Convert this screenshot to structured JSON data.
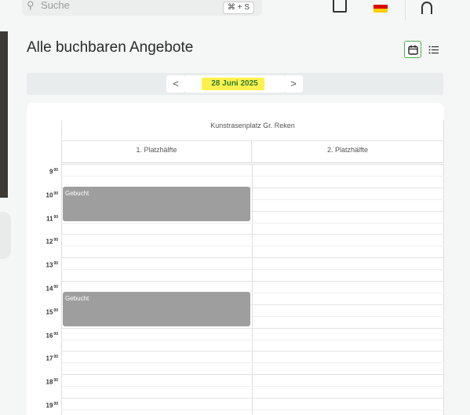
{
  "header": {
    "search_placeholder": "Suche",
    "shortcut": "⌘ + S",
    "flag_colors": [
      "#000000",
      "#dd0000",
      "#ffce00"
    ]
  },
  "page": {
    "title": "Alle buchbaren Angebote"
  },
  "view_toggle": {
    "active": "calendar",
    "options": [
      "calendar",
      "list"
    ],
    "accent_color": "#4caf50"
  },
  "date_nav": {
    "prev": "<",
    "date": "28 Juni 2025",
    "next": ">",
    "highlight_color": "#fff14d"
  },
  "calendar": {
    "venue": "Kunstrasenplatz Gr. Reken",
    "columns": [
      "1. Platzhälfte",
      "2. Platzhälfte"
    ],
    "hours": [
      {
        "h": "9",
        "m": "00"
      },
      {
        "h": "10",
        "m": "00"
      },
      {
        "h": "11",
        "m": "00"
      },
      {
        "h": "12",
        "m": "00"
      },
      {
        "h": "13",
        "m": "00"
      },
      {
        "h": "14",
        "m": "00"
      },
      {
        "h": "15",
        "m": "00"
      },
      {
        "h": "16",
        "m": "00"
      },
      {
        "h": "17",
        "m": "00"
      },
      {
        "h": "18",
        "m": "00"
      },
      {
        "h": "19",
        "m": "00"
      }
    ],
    "bookings": [
      {
        "label": "Gebucht",
        "column": "1. Platzhälfte",
        "start": "10:30",
        "end": "12:00"
      },
      {
        "label": "Gebucht",
        "column": "1. Platzhälfte",
        "start": "15:00",
        "end": "16:30"
      }
    ],
    "booking_color": "#9e9e9e"
  }
}
